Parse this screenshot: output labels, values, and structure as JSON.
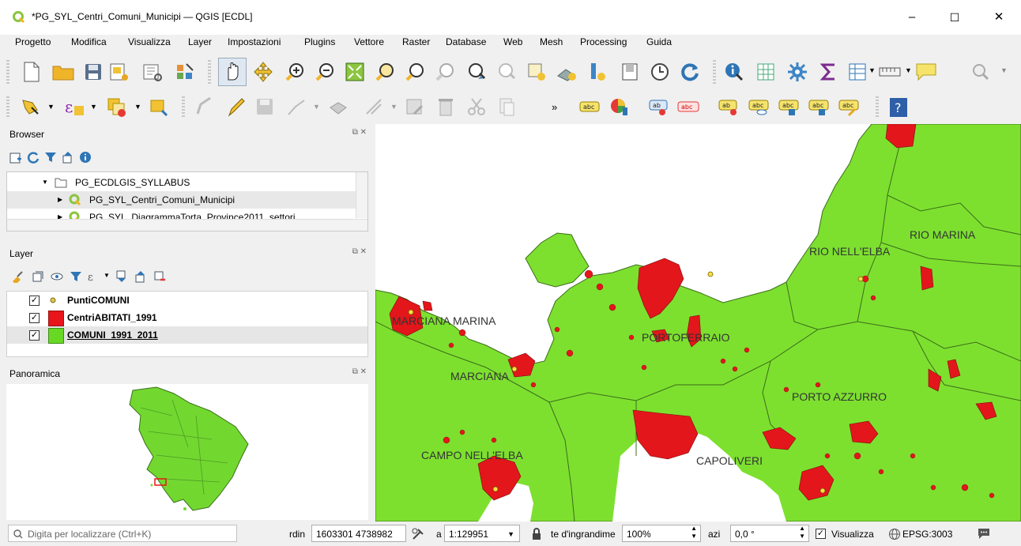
{
  "window": {
    "title": "*PG_SYL_Centri_Comuni_Municipi — QGIS [ECDL]",
    "minimize": "–",
    "maximize": "☐",
    "close": "✕"
  },
  "menu": [
    "Progetto",
    "Modifica",
    "Visualizza",
    "Layer",
    "Impostazioni",
    "Plugins",
    "Vettore",
    "Raster",
    "Database",
    "Web",
    "Mesh",
    "Processing",
    "Guida"
  ],
  "toolbar2": {
    "overflow": "»"
  },
  "browser": {
    "title": "Browser",
    "items": [
      {
        "label": "PG_ECDLGIS_SYLLABUS"
      },
      {
        "label": "PG_SYL_Centri_Comuni_Municipi"
      },
      {
        "label": "PG_SYL_DiagrammaTorta_Province2011_settori"
      }
    ]
  },
  "layers": {
    "title": "Layer",
    "items": [
      {
        "label": "PuntiCOMUNI",
        "checked": "✓",
        "color": "#d9c55a"
      },
      {
        "label": "CentriABITATI_1991",
        "checked": "✓",
        "color": "#e8161b"
      },
      {
        "label": "COMUNI_1991_2011",
        "checked": "✓",
        "color": "#67d925"
      }
    ]
  },
  "overview": {
    "title": "Panoramica"
  },
  "map": {
    "labels": [
      "RIO MARINA",
      "RIO NELL'ELBA",
      "MARCIANA MARINA",
      "PORTOFERRAIO",
      "MARCIANA",
      "PORTO AZZURRO",
      "CAMPO NELL'ELBA",
      "CAPOLIVERI"
    ],
    "land_color": "#7de02f",
    "urban_color": "#e3161b"
  },
  "status": {
    "locator_placeholder": "Digita per localizzare (Ctrl+K)",
    "coord_label": "rdin",
    "coord_value": "1603301 4738982",
    "scale_label": "a",
    "scale_value": "1:129951",
    "magnifier_label": "te d'ingrandime",
    "magnifier_value": "100%",
    "rotation_label": "azi",
    "rotation_value": "0,0 °",
    "render_checked": "✓",
    "render_label": "Visualizza",
    "crs": "EPSG:3003"
  }
}
